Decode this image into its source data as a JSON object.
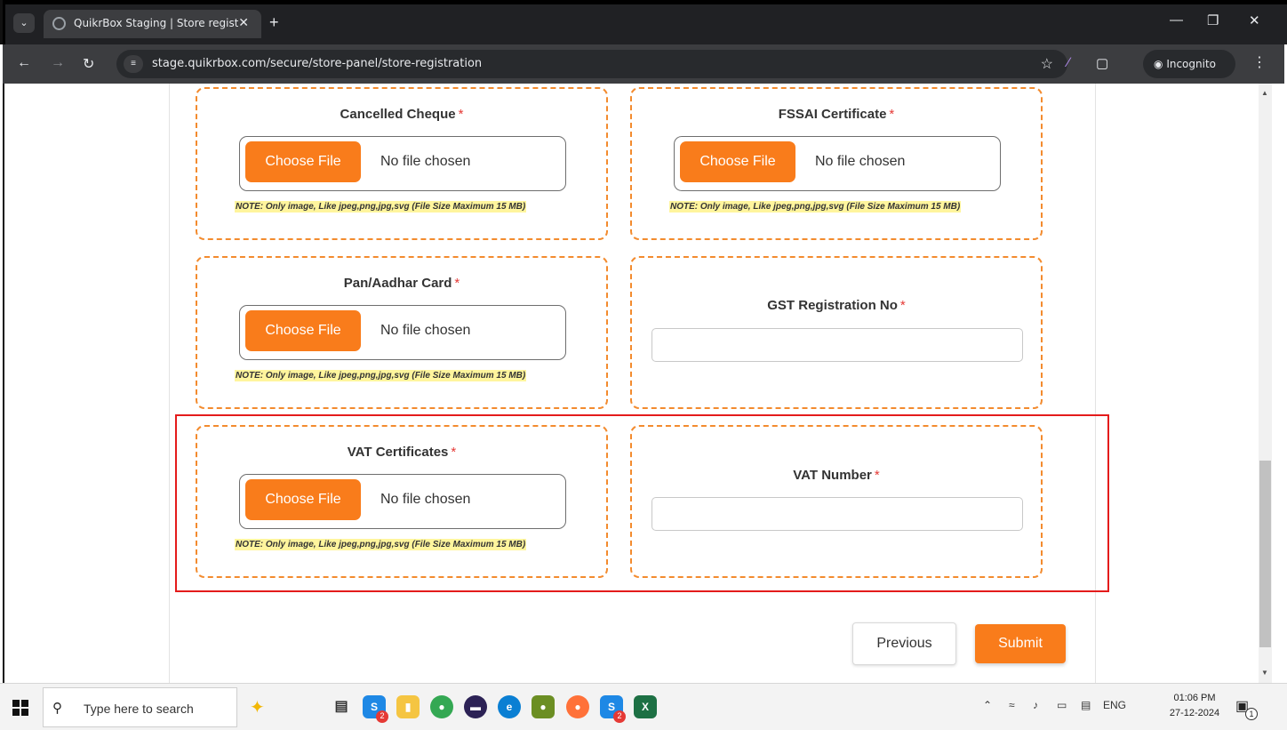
{
  "browser": {
    "tab_title": "QuikrBox Staging | Store registr",
    "url": "stage.quikrbox.com/secure/store-panel/store-registration",
    "incognito_label": "Incognito"
  },
  "form": {
    "required_mark": "*",
    "choose_file_label": "Choose File",
    "no_file_label": "No file chosen",
    "note_text": "NOTE: Only image, Like jpeg,png,jpg,svg (File Size Maximum 15 MB)",
    "fields": {
      "cancelled_cheque": "Cancelled Cheque",
      "fssai_certificate": "FSSAI Certificate",
      "pan_aadhar_card": "Pan/Aadhar Card",
      "gst_registration_no": "GST Registration No",
      "vat_certificates": "VAT Certificates",
      "vat_number": "VAT Number"
    },
    "gst_value": "",
    "vat_number_value": "",
    "previous_label": "Previous",
    "submit_label": "Submit"
  },
  "taskbar": {
    "search_placeholder": "Type here to search",
    "language": "ENG",
    "time": "01:06 PM",
    "date": "27-12-2024",
    "skype_badge": "2",
    "skype2_badge": "2",
    "notification_count": "1"
  },
  "colors": {
    "accent_orange": "#f97c1b",
    "card_border": "#f38b2e",
    "highlight_red": "#e41b1b",
    "note_bg": "#fff59d"
  }
}
